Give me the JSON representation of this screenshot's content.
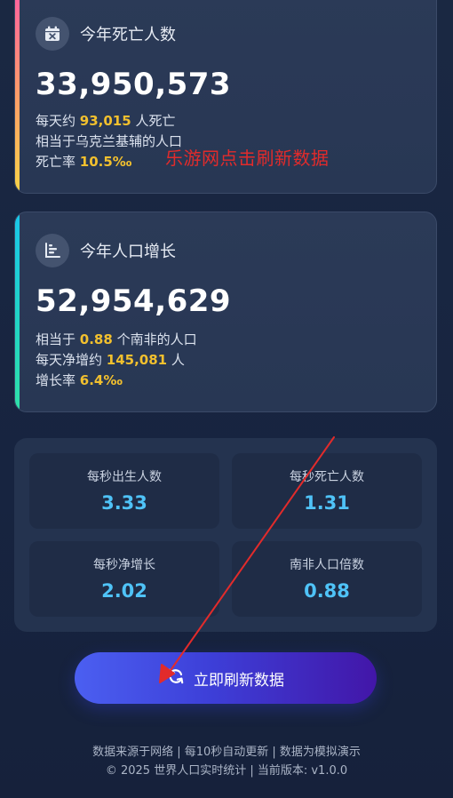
{
  "deaths_card": {
    "title": "今年死亡人数",
    "count": "33,950,573",
    "line1_prefix": "每天约 ",
    "line1_value": "93,015",
    "line1_suffix": " 人死亡",
    "line2": "相当于乌克兰基辅的人口",
    "line3_prefix": "死亡率 ",
    "line3_value": "10.5‰",
    "icon": "calendar-x-icon"
  },
  "watermark": "乐游网点击刷新数据",
  "growth_card": {
    "title": "今年人口增长",
    "count": "52,954,629",
    "line1_prefix": "相当于 ",
    "line1_value": "0.88",
    "line1_suffix": " 个南非的人口",
    "line2_prefix": "每天净增约 ",
    "line2_value": "145,081",
    "line2_suffix": " 人",
    "line3_prefix": "增长率 ",
    "line3_value": "6.4‰",
    "icon": "bar-chart-icon"
  },
  "stats": [
    {
      "label": "每秒出生人数",
      "value": "3.33"
    },
    {
      "label": "每秒死亡人数",
      "value": "1.31"
    },
    {
      "label": "每秒净增长",
      "value": "2.02"
    },
    {
      "label": "南非人口倍数",
      "value": "0.88"
    }
  ],
  "refresh_button": {
    "label": "立即刷新数据",
    "icon": "refresh-icon"
  },
  "footer": {
    "line1": "数据来源于网络 | 每10秒自动更新 | 数据为模拟演示",
    "line2": "© 2025 世界人口实时统计 | 当前版本: v1.0.0"
  },
  "colors": {
    "highlight": "#f2c02e",
    "stat_value": "#4fc3f7",
    "annotation": "#e22b2b"
  }
}
